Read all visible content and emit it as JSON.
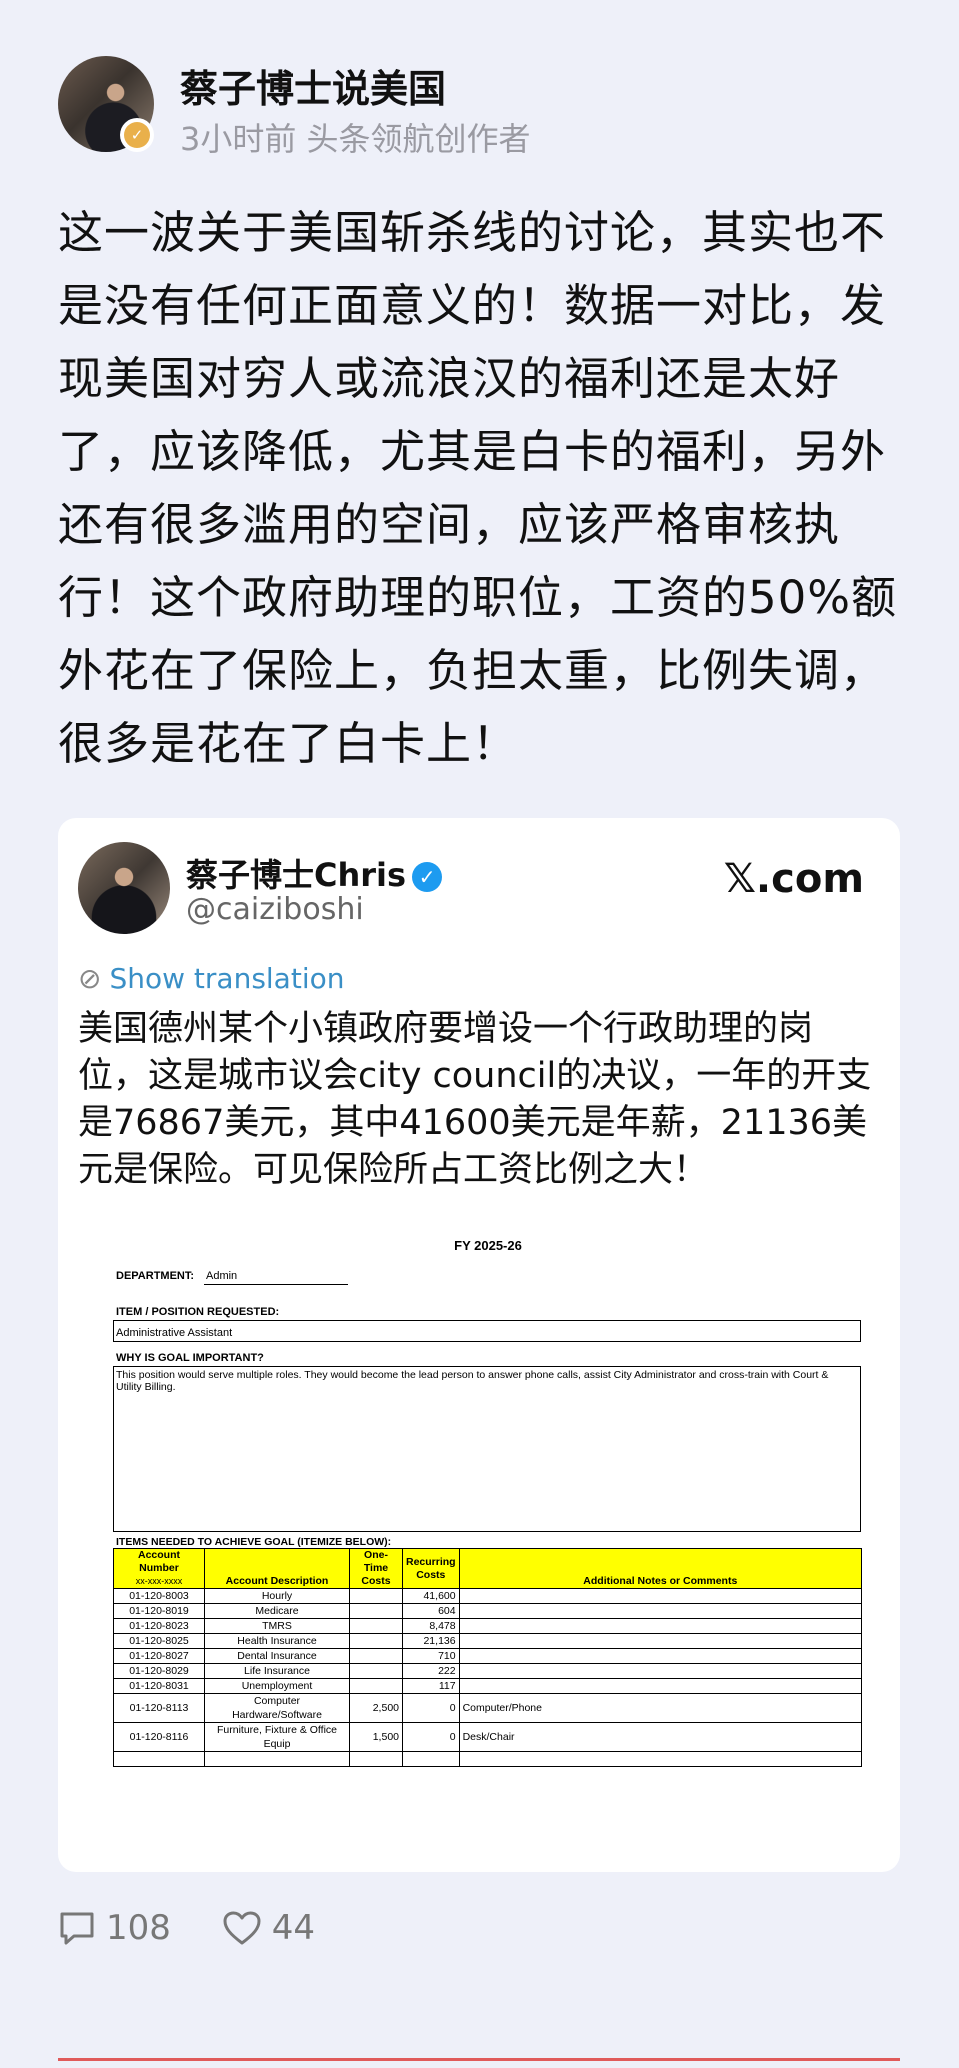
{
  "header": {
    "author": "蔡子博士说美国",
    "meta": "3小时前 头条领航创作者"
  },
  "post": {
    "text": "这一波关于美国斩杀线的讨论，其实也不是没有任何正面意义的！数据一对比，发现美国对穷人或流浪汉的福利还是太好了，应该降低，尤其是白卡的福利，另外还有很多滥用的空间，应该严格审核执行！这个政府助理的职位，工资的50%额外花在了保险上，负担太重，比例失调，很多是花在了白卡上！"
  },
  "card": {
    "name": "蔡子博士Chris",
    "handle": "@caiziboshi",
    "source": "𝕏.com",
    "translate_label": "Show translation",
    "text": "美国德州某个小镇政府要增设一个行政助理的岗位，这是城市议会city council的决议，一年的开支是76867美元，其中41600美元是年薪，21136美元是保险。可见保险所占工资比例之大！"
  },
  "document": {
    "fy": "FY 2025-26",
    "department_label": "DEPARTMENT:",
    "department_value": "Admin",
    "item_label": "ITEM / POSITION REQUESTED:",
    "item_value": "Administrative Assistant",
    "why_label": "WHY IS GOAL IMPORTANT?",
    "why_value": "This position would serve multiple roles.  They would become the lead person to answer phone calls, assist City Administrator and cross-train with Court & Utility Billing.",
    "items_label": "ITEMS NEEDED TO ACHIEVE GOAL (ITEMIZE BELOW):",
    "headers": {
      "account_number": "Account Number",
      "account_sub": "xx-xxx-xxxx",
      "description": "Account Description",
      "one_time": "One-Time Costs",
      "recurring": "Recurring Costs",
      "notes": "Additional Notes or Comments"
    },
    "rows": [
      {
        "account": "01-120-8003",
        "desc": "Hourly",
        "one_time": "",
        "recurring": "41,600",
        "notes": ""
      },
      {
        "account": "01-120-8019",
        "desc": "Medicare",
        "one_time": "",
        "recurring": "604",
        "notes": ""
      },
      {
        "account": "01-120-8023",
        "desc": "TMRS",
        "one_time": "",
        "recurring": "8,478",
        "notes": ""
      },
      {
        "account": "01-120-8025",
        "desc": "Health Insurance",
        "one_time": "",
        "recurring": "21,136",
        "notes": ""
      },
      {
        "account": "01-120-8027",
        "desc": "Dental Insurance",
        "one_time": "",
        "recurring": "710",
        "notes": ""
      },
      {
        "account": "01-120-8029",
        "desc": "Life Insurance",
        "one_time": "",
        "recurring": "222",
        "notes": ""
      },
      {
        "account": "01-120-8031",
        "desc": "Unemployment",
        "one_time": "",
        "recurring": "117",
        "notes": ""
      },
      {
        "account": "01-120-8113",
        "desc": "Computer Hardware/Software",
        "one_time": "2,500",
        "recurring": "0",
        "notes": "Computer/Phone"
      },
      {
        "account": "01-120-8116",
        "desc": "Furniture, Fixture & Office Equip",
        "one_time": "1,500",
        "recurring": "0",
        "notes": "Desk/Chair"
      },
      {
        "account": "",
        "desc": "",
        "one_time": "",
        "recurring": "",
        "notes": ""
      }
    ]
  },
  "footer": {
    "comments": "108",
    "likes": "44"
  },
  "colors": {
    "background": "#eef0f9",
    "link": "#3a8fc6",
    "verified": "#1d9bf0",
    "table_header": "#ffff00"
  }
}
